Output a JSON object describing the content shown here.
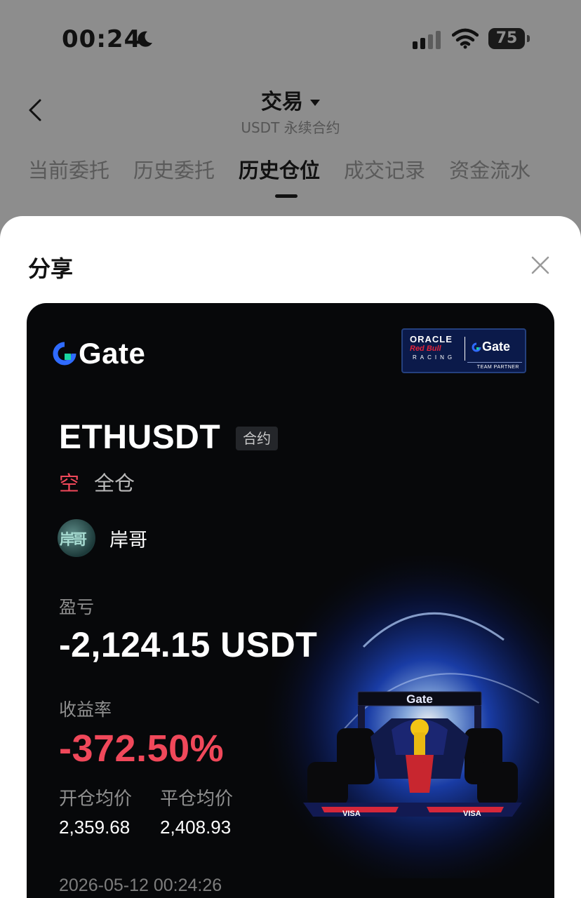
{
  "status_bar": {
    "time": "00:24",
    "battery": "75"
  },
  "nav": {
    "title": "交易",
    "subtitle": "USDT 永续合约"
  },
  "tabs": [
    {
      "label": "当前委托",
      "active": false
    },
    {
      "label": "历史委托",
      "active": false
    },
    {
      "label": "历史仓位",
      "active": true
    },
    {
      "label": "成交记录",
      "active": false
    },
    {
      "label": "资金流水",
      "active": false
    }
  ],
  "sheet": {
    "title": "分享"
  },
  "card": {
    "brand": "Gate",
    "partner": {
      "oracle": "ORACLE",
      "redbull": "Red Bull",
      "racing": "RACING",
      "gate": "Gate",
      "team": "TEAM PARTNER"
    },
    "symbol": "ETHUSDT",
    "contract_tag": "合约",
    "side": "空",
    "margin_mode": "全仓",
    "user": {
      "avatar_text": "岸哥",
      "name": "岸哥"
    },
    "pnl_label": "盈亏",
    "pnl_value": "-2,124.15 USDT",
    "roi_label": "收益率",
    "roi_value": "-372.50%",
    "open_price_label": "开仓均价",
    "open_price": "2,359.68",
    "close_price_label": "平仓均价",
    "close_price": "2,408.93",
    "timestamp": "2026-05-12 00:24:26",
    "car_livery_text": "Gate",
    "car_wing_text": "VISA"
  },
  "colors": {
    "accent_negative": "#f0485a",
    "gate_blue": "#2f6bff",
    "card_bg": "#07080a"
  }
}
